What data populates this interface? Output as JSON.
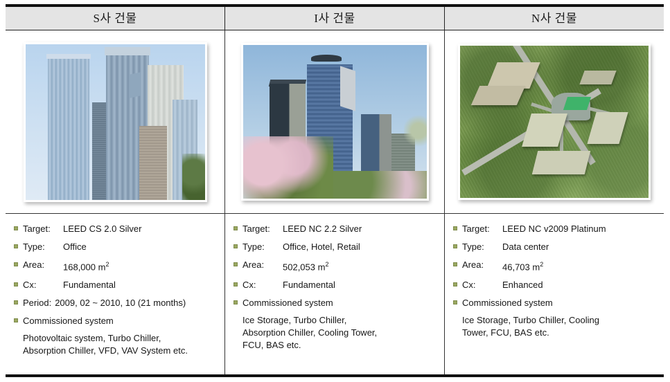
{
  "table": {
    "columns": [
      {
        "header": "S사 건물",
        "photo_alt": "glass-skyscrapers-photo",
        "specs": [
          {
            "label": "Target:",
            "value": "LEED CS 2.0 Silver"
          },
          {
            "label": "Type:",
            "value": "Office"
          },
          {
            "label": "Area:",
            "value": "168,000 m",
            "sup": "2"
          },
          {
            "label": "Cx:",
            "value": "Fundamental"
          },
          {
            "label": "Period:",
            "value": "2009, 02 ~ 2010, 10 (21 months)"
          }
        ],
        "commissioned_heading": "Commissioned  system",
        "commissioned_text": "Photovoltaic system, Turbo Chiller,\nAbsorption Chiller, VFD, VAV System etc."
      },
      {
        "header": "I사 건물",
        "photo_alt": "towers-with-cherry-blossoms-photo",
        "specs": [
          {
            "label": "Target:",
            "value": "LEED NC 2.2 Silver"
          },
          {
            "label": "Type:",
            "value": "Office, Hotel, Retail"
          },
          {
            "label": "Area:",
            "value": "502,053 m",
            "sup": "2"
          },
          {
            "label": "Cx:",
            "value": "Fundamental"
          }
        ],
        "commissioned_heading": "Commissioned  system",
        "commissioned_text": "Ice Storage, Turbo  Chiller,\nAbsorption  Chiller, Cooling Tower,\nFCU,  BAS etc."
      },
      {
        "header": "N사 건물",
        "photo_alt": "aerial-campus-rendering",
        "specs": [
          {
            "label": "Target:",
            "value": "LEED NC v2009 Platinum"
          },
          {
            "label": "Type:",
            "value": "Data center"
          },
          {
            "label": "Area:",
            "value": "46,703 m",
            "sup": "2"
          },
          {
            "label": "Cx:",
            "value": "Enhanced"
          }
        ],
        "commissioned_heading": "Commissioned  system",
        "commissioned_text": "Ice Storage, Turbo  Chiller, Cooling\nTower, FCU, BAS etc."
      }
    ]
  },
  "colors": {
    "header_bg": "#e4e4e4",
    "border": "#111111",
    "bullet": "#9aa861",
    "text": "#171717"
  }
}
